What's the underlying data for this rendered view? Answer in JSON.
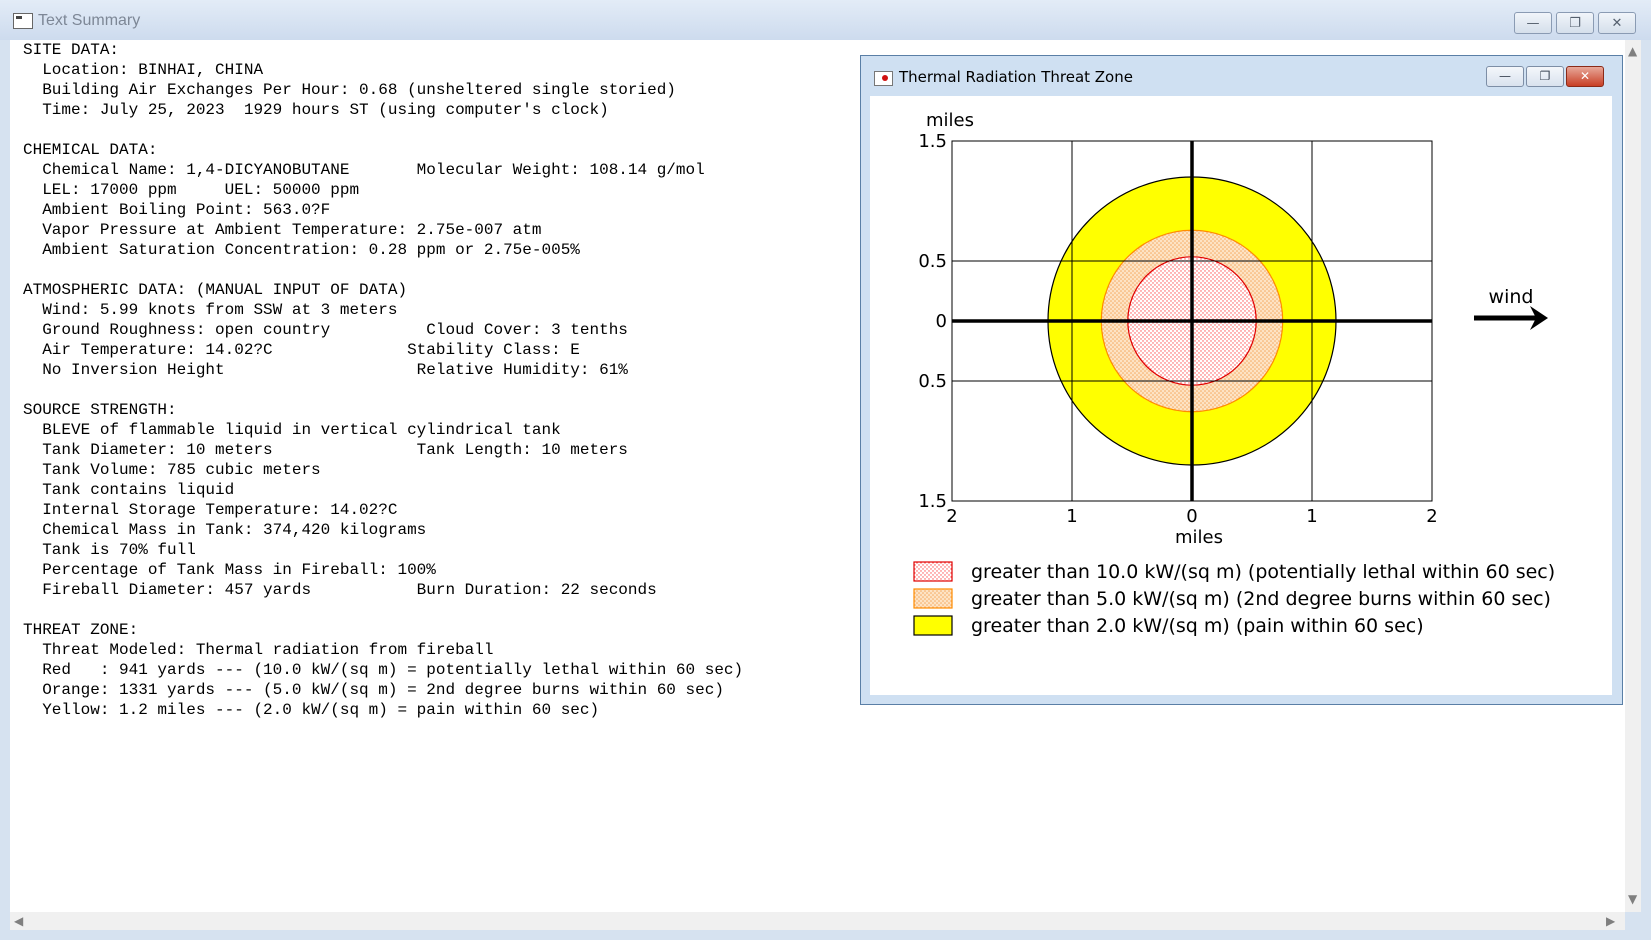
{
  "window": {
    "title": "Text Summary",
    "icons": {
      "app": "window-app-icon",
      "minimize": "minimize-icon",
      "maximize": "maximize-icon",
      "close": "close-icon"
    }
  },
  "summary_lines": [
    "SITE DATA:",
    "  Location: BINHAI, CHINA",
    "  Building Air Exchanges Per Hour: 0.68 (unsheltered single storied)",
    "  Time: July 25, 2023  1929 hours ST (using computer's clock)",
    "",
    "CHEMICAL DATA:",
    "  Chemical Name: 1,4-DICYANOBUTANE       Molecular Weight: 108.14 g/mol",
    "  LEL: 17000 ppm     UEL: 50000 ppm",
    "  Ambient Boiling Point: 563.0?F",
    "  Vapor Pressure at Ambient Temperature: 2.75e-007 atm",
    "  Ambient Saturation Concentration: 0.28 ppm or 2.75e-005%",
    "",
    "ATMOSPHERIC DATA: (MANUAL INPUT OF DATA)",
    "  Wind: 5.99 knots from SSW at 3 meters",
    "  Ground Roughness: open country          Cloud Cover: 3 tenths",
    "  Air Temperature: 14.02?C              Stability Class: E",
    "  No Inversion Height                    Relative Humidity: 61%",
    "",
    "SOURCE STRENGTH:",
    "  BLEVE of flammable liquid in vertical cylindrical tank",
    "  Tank Diameter: 10 meters               Tank Length: 10 meters",
    "  Tank Volume: 785 cubic meters",
    "  Tank contains liquid",
    "  Internal Storage Temperature: 14.02?C",
    "  Chemical Mass in Tank: 374,420 kilograms",
    "  Tank is 70% full",
    "  Percentage of Tank Mass in Fireball: 100%",
    "  Fireball Diameter: 457 yards           Burn Duration: 22 seconds",
    "",
    "THREAT ZONE:",
    "  Threat Modeled: Thermal radiation from fireball",
    "  Red   : 941 yards --- (10.0 kW/(sq m) = potentially lethal within 60 sec)",
    "  Orange: 1331 yards --- (5.0 kW/(sq m) = 2nd degree burns within 60 sec)",
    "  Yellow: 1.2 miles --- (2.0 kW/(sq m) = pain within 60 sec)"
  ],
  "threat_window": {
    "title": "Thermal Radiation Threat Zone",
    "icons": {
      "app": "threat-zone-app-icon",
      "minimize": "minimize-icon",
      "maximize": "maximize-icon",
      "close": "close-icon"
    }
  },
  "chart_data": {
    "type": "threat-zone-plot",
    "xlabel": "miles",
    "ylabel": "miles",
    "xlim": [
      -2,
      2
    ],
    "ylim": [
      -1.5,
      1.5
    ],
    "x_tick_labels": [
      "2",
      "1",
      "0",
      "1",
      "2"
    ],
    "x_ticks": [
      -2,
      -1,
      0,
      1,
      2
    ],
    "y_tick_labels": [
      "1.5",
      "0.5",
      "0",
      "0.5",
      "1.5"
    ],
    "y_ticks": [
      1.5,
      0.5,
      0,
      -0.5,
      -1.5
    ],
    "wind_label": "wind",
    "wind_direction": "right",
    "zones": [
      {
        "radius_miles": 1.2,
        "color": "#ffff00",
        "pattern": "solid",
        "outline": "#000000",
        "legend": "greater than 2.0 kW/(sq m) (pain within 60 sec)"
      },
      {
        "radius_miles": 0.756,
        "color": "#fbd3a6",
        "pattern": "orange-dots",
        "outline": "#ff8c00",
        "legend": "greater than 5.0 kW/(sq m) (2nd degree burns within 60 sec)"
      },
      {
        "radius_miles": 0.535,
        "color": "#ffe8e8",
        "pattern": "red-dots",
        "outline": "#e00000",
        "legend": "greater than 10.0 kW/(sq m) (potentially lethal within 60 sec)"
      }
    ],
    "legend_order": [
      2,
      1,
      0
    ]
  }
}
